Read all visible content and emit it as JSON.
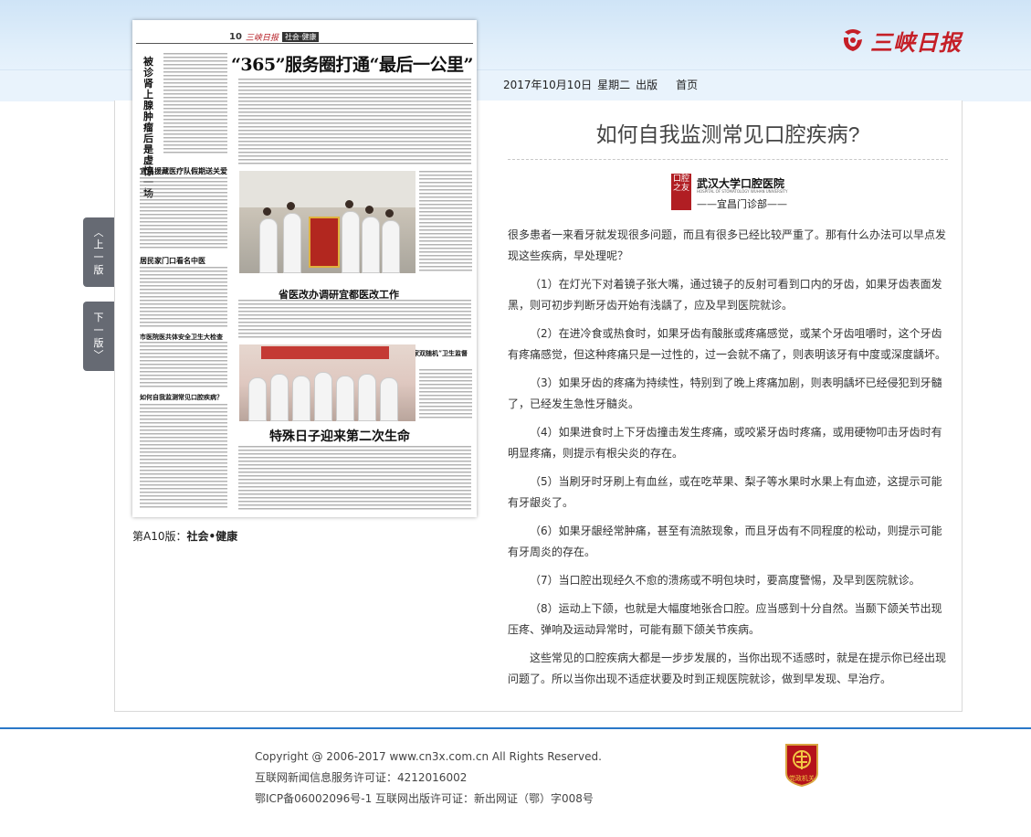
{
  "brand": {
    "name": "三峡日报",
    "color": "#c51f27"
  },
  "date_line": {
    "date": "2017年10月10日",
    "weekday": "星期二",
    "label": "出版",
    "home": "首页"
  },
  "side_nav": {
    "prev": [
      "上",
      "一",
      "版"
    ],
    "next": [
      "下",
      "一",
      "版"
    ]
  },
  "paper": {
    "page_no": "10",
    "logo": "三峡日报",
    "section": "社会·健康",
    "main_headline": "“365”服务圈打通“最后一公里”",
    "headlines": [
      "被诊肾上腺肿瘤后是虚惊一场",
      "宜昌援藏医疗队假期送关爱",
      "居民家门口看名中医",
      "省医改办调研宜都医改工作",
      "市医院医共体安全卫生大检查",
      "如何自我监测常见口腔疾病？",
      "点军启动“国家双随机”卫生监督执法检查",
      "特殊日子迎来第二次生命"
    ]
  },
  "caption": {
    "prefix": "第A10版：",
    "section": "社会•健康"
  },
  "article": {
    "title": "如何自我监测常见口腔疾病?",
    "emblem": {
      "seal": "口腔之友",
      "name": "武汉大学口腔医院",
      "sub": "HOSPITAL OF STOMATOLOGY WUHAN UNIVERSITY",
      "branch": "——宜昌门诊部——"
    },
    "intro": "很多患者一来看牙就发现很多问题，而且有很多已经比较严重了。那有什么办法可以早点发现这些疾病，早处理呢？",
    "items": [
      "（1）在灯光下对着镜子张大嘴，通过镜子的反射可看到口内的牙齿，如果牙齿表面发黑，则可初步判断牙齿开始有浅龋了，应及早到医院就诊。",
      "（2）在进冷食或热食时，如果牙齿有酸胀或疼痛感觉，或某个牙齿咀嚼时，这个牙齿有疼痛感觉，但这种疼痛只是一过性的，过一会就不痛了，则表明该牙有中度或深度龋坏。",
      "（3）如果牙齿的疼痛为持续性，特别到了晚上疼痛加剧，则表明龋坏已经侵犯到牙髓了，已经发生急性牙髓炎。",
      "（4）如果进食时上下牙齿撞击发生疼痛，或咬紧牙齿时疼痛，或用硬物叩击牙齿时有明显疼痛，则提示有根尖炎的存在。",
      "（5）当刷牙时牙刷上有血丝，或在吃苹果、梨子等水果时水果上有血迹，这提示可能有牙龈炎了。",
      "（6）如果牙龈经常肿痛，甚至有流脓现象，而且牙齿有不同程度的松动，则提示可能有牙周炎的存在。",
      "（7）当口腔出现经久不愈的溃疡或不明包块时，要高度警惕，及早到医院就诊。",
      "（8）运动上下颌，也就是大幅度地张合口腔。应当感到十分自然。当颞下颌关节出现压疼、弹响及运动异常时，可能有颞下颌关节疾病。"
    ],
    "outro": "这些常见的口腔疾病大都是一步步发展的，当你出现不适感时，就是在提示你已经出现问题了。所以当你出现不适症状要及时到正规医院就诊，做到早发现、早治疗。"
  },
  "footer": {
    "copyright": "Copyright @ 2006-2017 www.cn3x.com.cn All Rights Reserved.",
    "license": "互联网新闻信息服务许可证：4212016002",
    "icp": "鄂ICP备06002096号-1 互联网出版许可证：新出网证（鄂）字008号",
    "badge": "党政机关"
  },
  "colors": {
    "accent_blue": "#2a78c8",
    "tab_gray": "#666a73",
    "brand_red": "#c51f27"
  }
}
